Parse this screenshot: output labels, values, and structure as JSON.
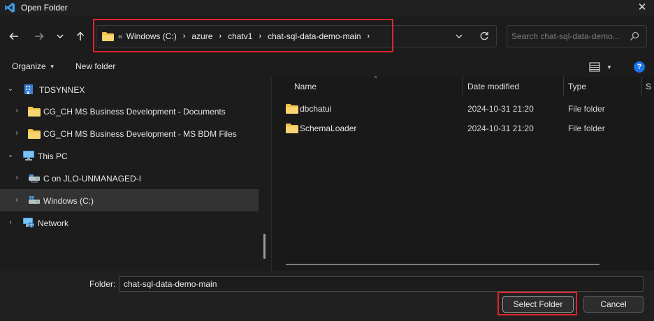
{
  "window": {
    "title": "Open Folder"
  },
  "address": {
    "overflow_marker": "«",
    "crumbs": [
      "Windows (C:)",
      "azure",
      "chatv1",
      "chat-sql-data-demo-main"
    ],
    "separator": "›"
  },
  "search": {
    "placeholder": "Search chat-sql-data-demo..."
  },
  "toolbar": {
    "organize_label": "Organize",
    "new_folder_label": "New folder",
    "help_label": "?"
  },
  "sidebar": {
    "items": [
      {
        "label": "TDSYNNEX",
        "icon": "building-icon",
        "expanded": true
      },
      {
        "label": "CG_CH MS Business Development - Documents",
        "icon": "folder-icon",
        "expanded": false
      },
      {
        "label": "CG_CH MS Business Development - MS BDM Files",
        "icon": "folder-icon",
        "expanded": false
      },
      {
        "label": "This PC",
        "icon": "computer-icon",
        "expanded": true
      },
      {
        "label": "C on JLO-UNMANAGED-I",
        "icon": "network-drive-icon",
        "expanded": false
      },
      {
        "label": "Windows (C:)",
        "icon": "drive-icon",
        "expanded": false,
        "selected": true
      },
      {
        "label": "Network",
        "icon": "network-icon",
        "expanded": false
      }
    ]
  },
  "files": {
    "columns": [
      "Name",
      "Date modified",
      "Type",
      "S"
    ],
    "rows": [
      {
        "name": "dbchatui",
        "date": "2024-10-31 21:20",
        "type": "File folder"
      },
      {
        "name": "SchemaLoader",
        "date": "2024-10-31 21:20",
        "type": "File folder"
      }
    ]
  },
  "footer": {
    "folder_label": "Folder:",
    "folder_value": "chat-sql-data-demo-main",
    "select_label": "Select Folder",
    "cancel_label": "Cancel"
  },
  "colors": {
    "highlight": "#e3242b",
    "folder": "#f3c247",
    "accent": "#1a73e8"
  }
}
